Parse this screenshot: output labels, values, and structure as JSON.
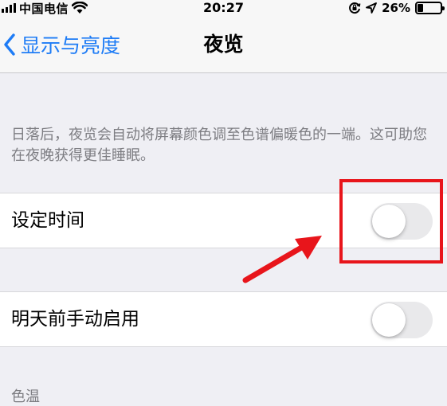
{
  "status_bar": {
    "carrier": "中国电信",
    "time": "20:27",
    "battery": "26%",
    "battery_level": 0.26,
    "icons": [
      "signal-bars-icon",
      "wifi-icon",
      "orientation-lock-icon",
      "location-arrow-icon",
      "battery-icon"
    ]
  },
  "nav": {
    "back_label": "显示与亮度",
    "back_icon": "chevron-left-icon",
    "title": "夜览"
  },
  "description": "日落后，夜览会自动将屏幕颜色调至色谱偏暖色的一端。这可助您在夜晚获得更佳睡眠。",
  "settings": [
    {
      "label": "设定时间",
      "on": false
    },
    {
      "label": "明天前手动启用",
      "on": false
    }
  ],
  "section_label": "色温",
  "colors": {
    "accent": "#1e7cf6",
    "annotation": "#e8151b",
    "background": "#efeff4"
  }
}
